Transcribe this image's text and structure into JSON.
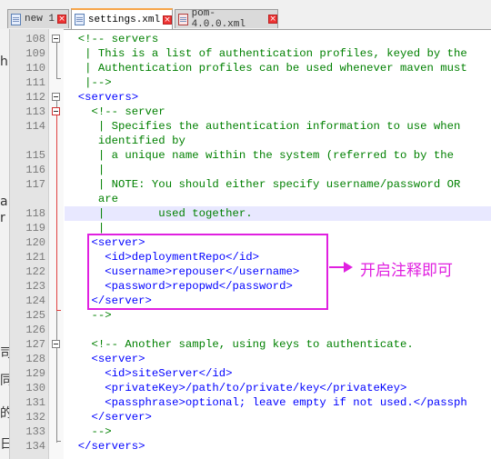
{
  "tabs": [
    {
      "label": "new 1",
      "active": false
    },
    {
      "label": "settings.xml",
      "active": true
    },
    {
      "label": "pom-4.0.0.xml",
      "active": false
    }
  ],
  "tab_close_glyph": "×",
  "left_edge_glyphs": [
    "h",
    "a",
    "r",
    "司",
    "同",
    "的",
    "日"
  ],
  "lines": [
    {
      "num": "108",
      "code": "  <!-- servers",
      "kind": "comment"
    },
    {
      "num": "109",
      "code": "   | This is a list of authentication profiles, keyed by the",
      "kind": "comment"
    },
    {
      "num": "110",
      "code": "   | Authentication profiles can be used whenever maven must",
      "kind": "comment"
    },
    {
      "num": "111",
      "code": "   |-->",
      "kind": "comment"
    },
    {
      "num": "112",
      "code": "  <servers>",
      "kind": "tag"
    },
    {
      "num": "113",
      "code": "    <!-- server",
      "kind": "comment"
    },
    {
      "num": "114",
      "code": "     | Specifies the authentication information to use when",
      "kind": "comment"
    },
    {
      "num": "",
      "code": "     identified by",
      "kind": "comment"
    },
    {
      "num": "115",
      "code": "     | a unique name within the system (referred to by the",
      "kind": "comment"
    },
    {
      "num": "116",
      "code": "     |",
      "kind": "comment"
    },
    {
      "num": "117",
      "code": "     | NOTE: You should either specify username/password OR",
      "kind": "comment"
    },
    {
      "num": "",
      "code": "     are",
      "kind": "comment"
    },
    {
      "num": "118",
      "code": "     |        used together.",
      "kind": "comment"
    },
    {
      "num": "119",
      "code": "     |",
      "kind": "comment"
    },
    {
      "num": "120",
      "code": "    <server>",
      "kind": "tag"
    },
    {
      "num": "121",
      "code": "      <id>deploymentRepo</id>",
      "kind": "tag"
    },
    {
      "num": "122",
      "code": "      <username>repouser</username>",
      "kind": "tag"
    },
    {
      "num": "123",
      "code": "      <password>repopwd</password>",
      "kind": "tag"
    },
    {
      "num": "124",
      "code": "    </server>",
      "kind": "tag"
    },
    {
      "num": "125",
      "code": "    -->",
      "kind": "comment"
    },
    {
      "num": "126",
      "code": "",
      "kind": "plain"
    },
    {
      "num": "127",
      "code": "    <!-- Another sample, using keys to authenticate.",
      "kind": "comment"
    },
    {
      "num": "128",
      "code": "    <server>",
      "kind": "tag"
    },
    {
      "num": "129",
      "code": "      <id>siteServer</id>",
      "kind": "tag"
    },
    {
      "num": "130",
      "code": "      <privateKey>/path/to/private/key</privateKey>",
      "kind": "tag"
    },
    {
      "num": "131",
      "code": "      <passphrase>optional; leave empty if not used.</passph",
      "kind": "tag"
    },
    {
      "num": "132",
      "code": "    </server>",
      "kind": "tag"
    },
    {
      "num": "133",
      "code": "    -->",
      "kind": "comment"
    },
    {
      "num": "134",
      "code": "  </servers>",
      "kind": "tag"
    }
  ],
  "annotation": {
    "text": "开启注释即可"
  },
  "colors": {
    "comment": "#008000",
    "tag": "#0000ff",
    "annotation": "#e020e0",
    "active_tab_accent": "#f7a54a",
    "current_line": "#e8e8ff"
  }
}
